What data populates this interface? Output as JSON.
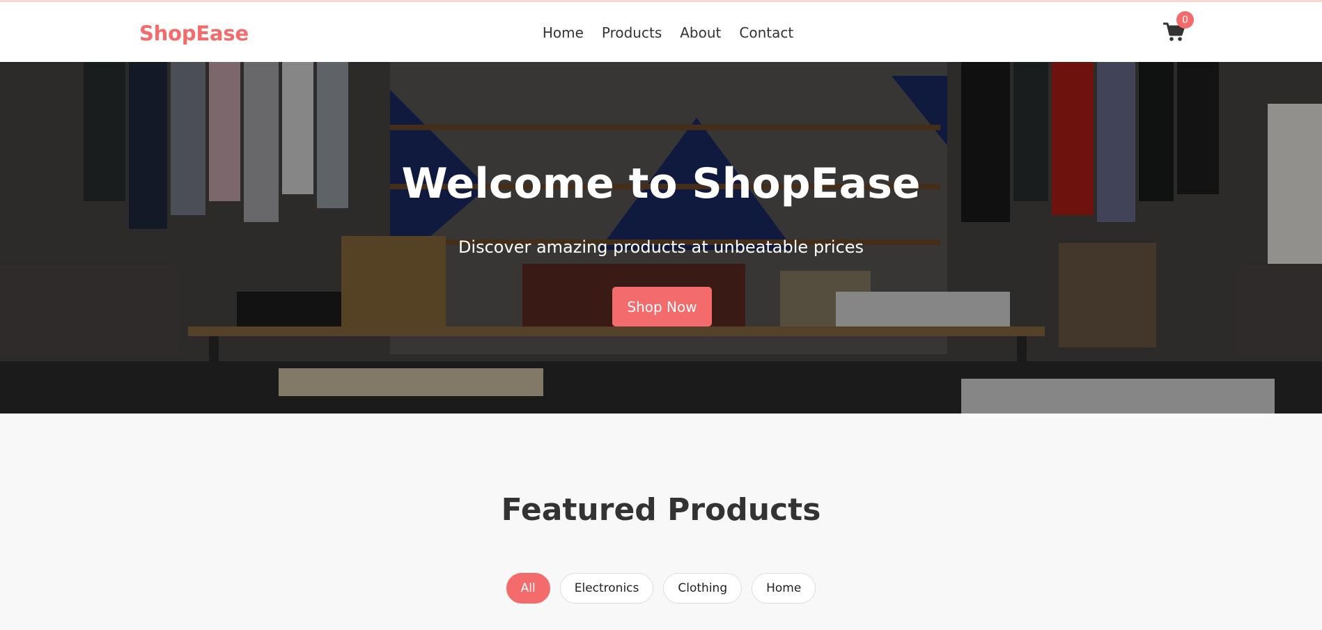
{
  "brand": {
    "name": "ShopEase",
    "accent": "#f36b6b"
  },
  "nav": {
    "links": [
      {
        "label": "Home"
      },
      {
        "label": "Products"
      },
      {
        "label": "About"
      },
      {
        "label": "Contact"
      }
    ]
  },
  "cart": {
    "icon": "cart-icon",
    "count": "0"
  },
  "hero": {
    "title": "Welcome to ShopEase",
    "subtitle": "Discover amazing products at unbeatable prices",
    "cta_label": "Shop Now"
  },
  "featured": {
    "title": "Featured Products",
    "filters": [
      {
        "label": "All",
        "active": true
      },
      {
        "label": "Electronics",
        "active": false
      },
      {
        "label": "Clothing",
        "active": false
      },
      {
        "label": "Home",
        "active": false
      }
    ]
  }
}
